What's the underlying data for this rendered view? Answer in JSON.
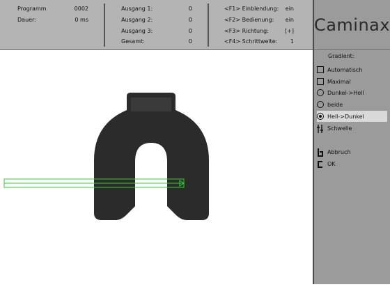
{
  "header": {
    "col1": [
      {
        "label": "Programm",
        "value": "0002"
      },
      {
        "label": "Dauer:",
        "value": "0 ms"
      }
    ],
    "col2": [
      {
        "label": "Ausgang 1:",
        "value": "0"
      },
      {
        "label": "Ausgang 2:",
        "value": "0"
      },
      {
        "label": "Ausgang 3:",
        "value": "0"
      },
      {
        "label": "Gesamt:",
        "value": "0"
      }
    ],
    "col3": [
      {
        "label": "<F1> Einblendung:",
        "value": "ein"
      },
      {
        "label": "<F2> Bedienung:",
        "value": "ein"
      },
      {
        "label": "<F3> Richtung:",
        "value": "[+]"
      },
      {
        "label": "<F4> Schrittweite:",
        "value": "1"
      }
    ]
  },
  "brand": {
    "logo": "Caminax"
  },
  "panel": {
    "title": "Gradient:",
    "options": [
      {
        "label": "Automatisch",
        "icon": "checkbox-icon",
        "checked": false
      },
      {
        "label": "Maximal",
        "icon": "checkbox-icon",
        "checked": false
      },
      {
        "label": "Dunkel->Hell",
        "icon": "radio-icon",
        "checked": false
      },
      {
        "label": "beide",
        "icon": "radio-icon",
        "checked": false
      },
      {
        "label": "Hell->Dunkel",
        "icon": "radio-icon",
        "checked": true
      },
      {
        "label": "Schwelle",
        "icon": "threshold-icon",
        "checked": false
      }
    ],
    "actions": [
      {
        "label": "Abbruch",
        "icon": "cancel-icon"
      },
      {
        "label": "OK",
        "icon": "ok-icon"
      }
    ]
  },
  "colors": {
    "toolbar": "#b4b4b4",
    "panel": "#9b9b9b",
    "selection": "#d9d9d9",
    "roi": "#2fcf2f",
    "part": "#2b2b2b"
  }
}
